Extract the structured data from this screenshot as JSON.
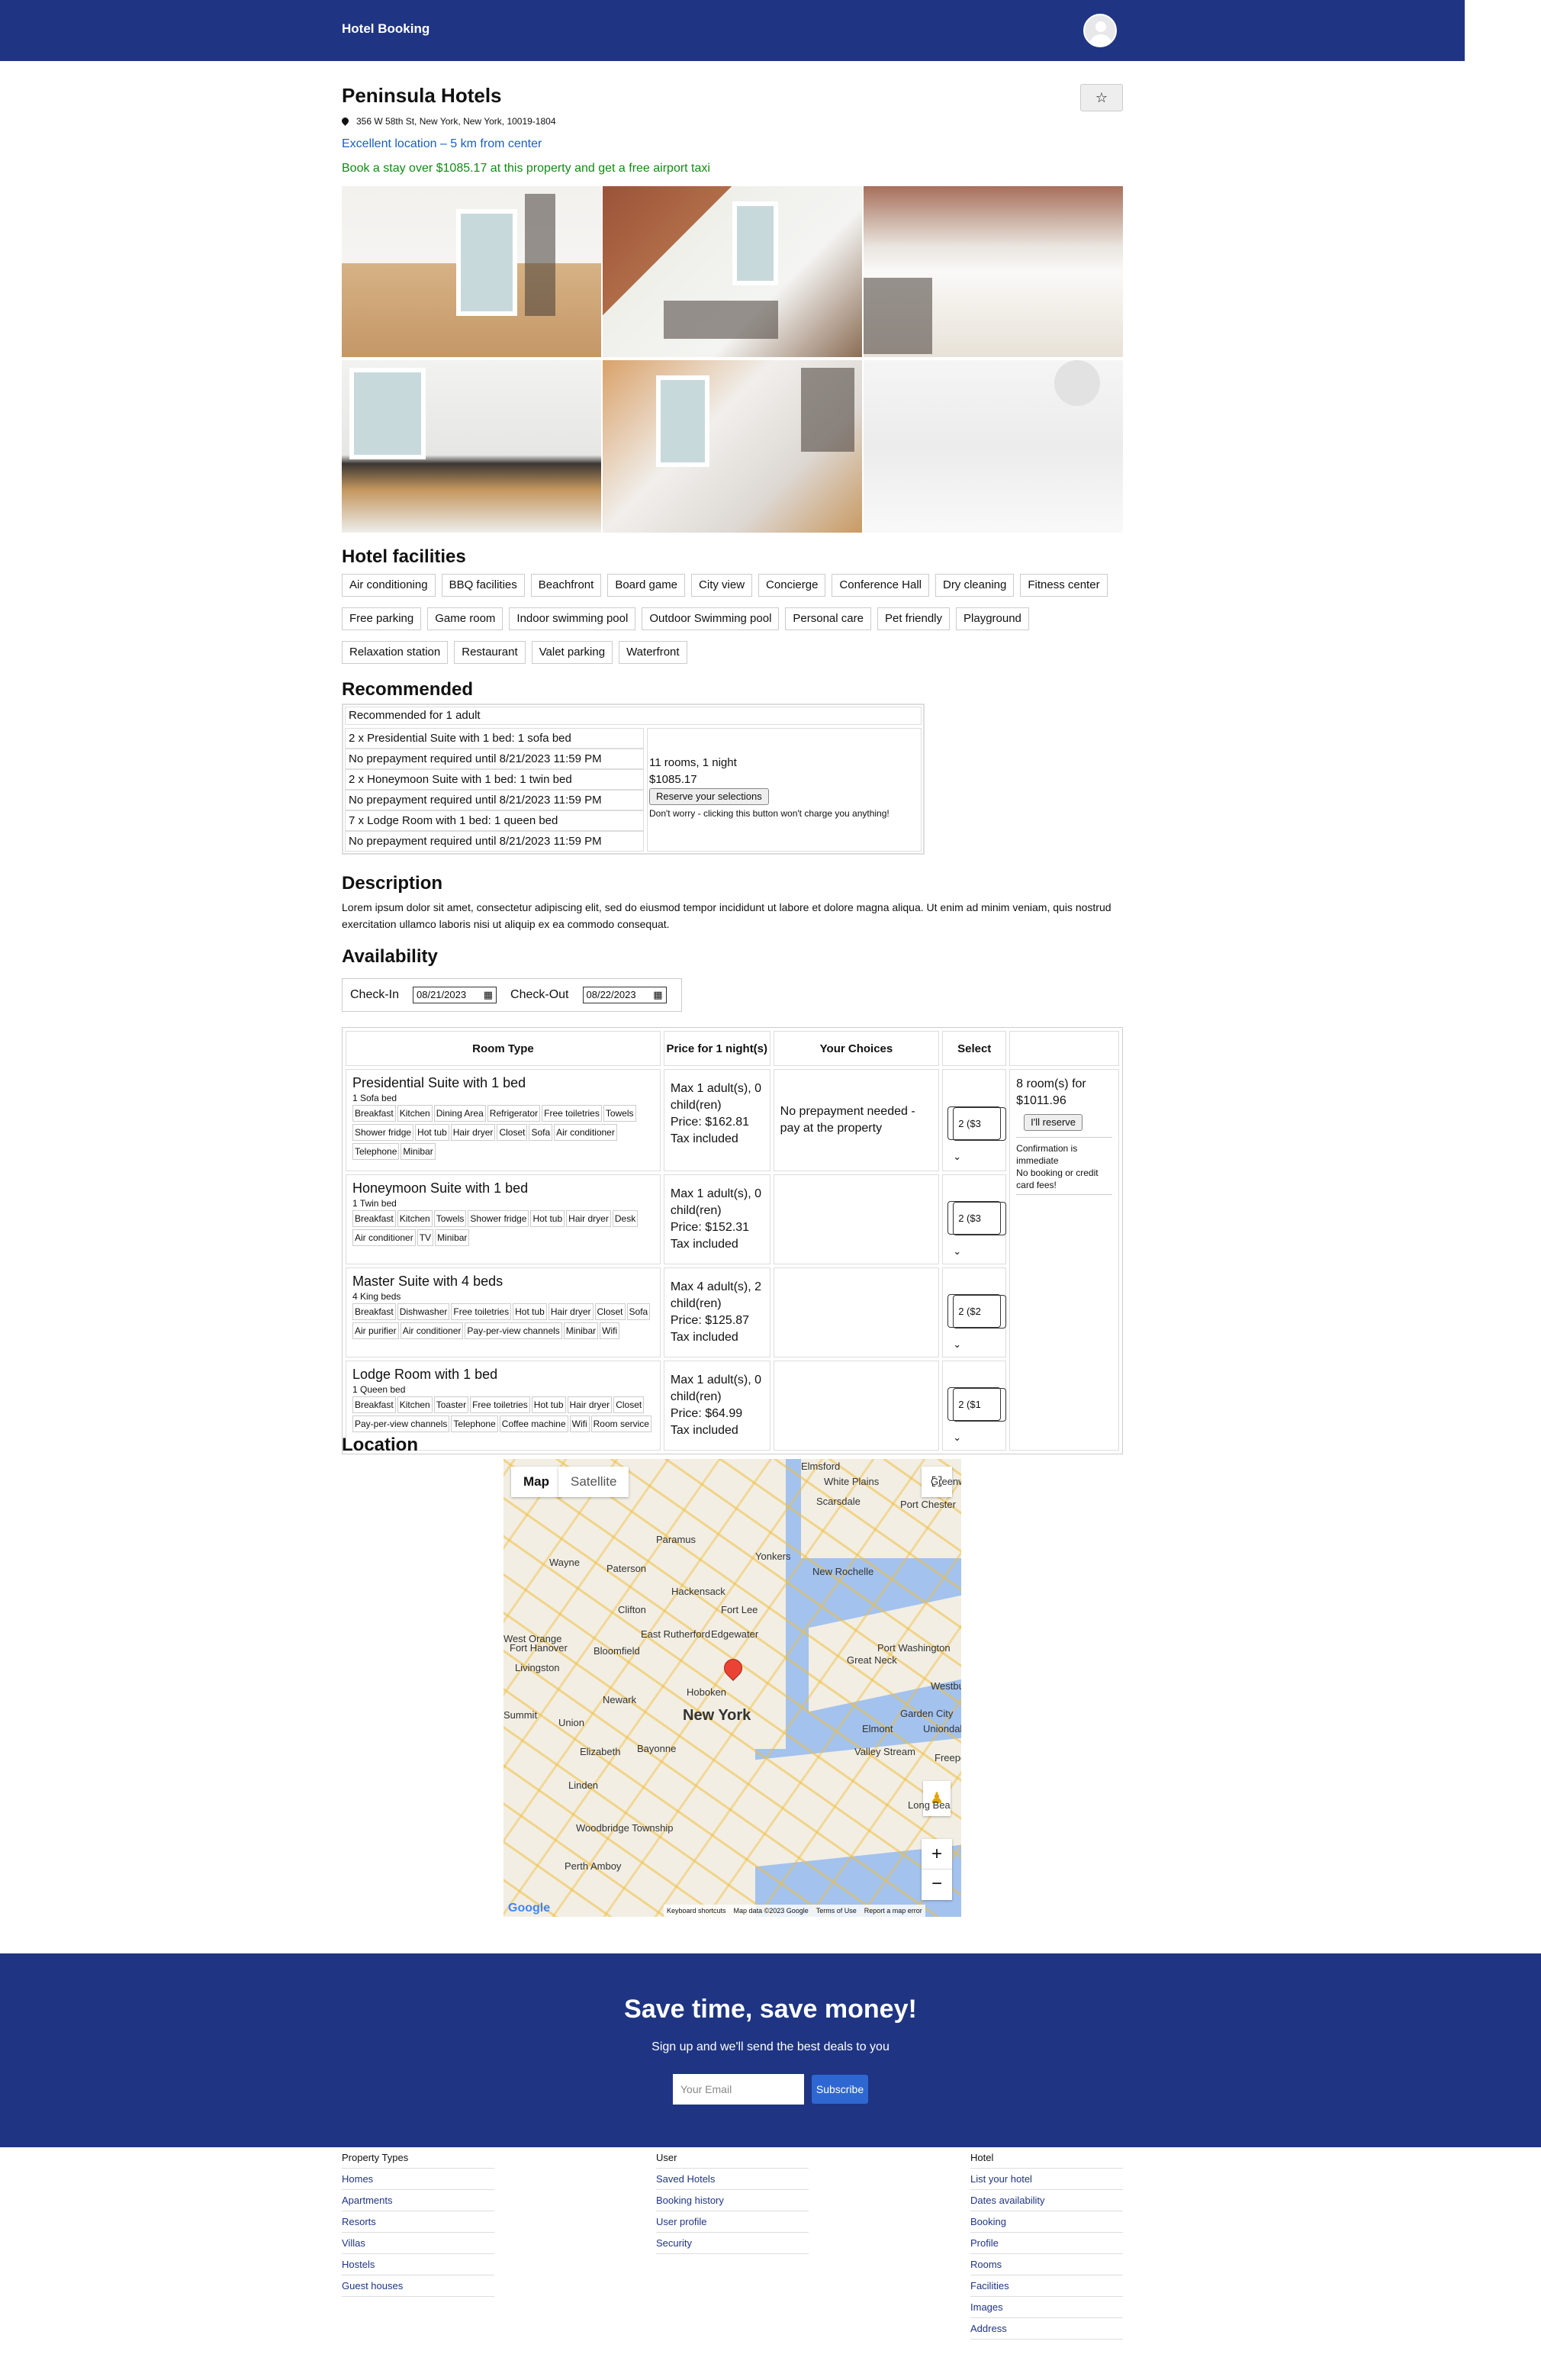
{
  "header": {
    "brand": "Hotel Booking",
    "avatar_icon": "user-avatar-icon"
  },
  "hotel": {
    "name": "Peninsula Hotels",
    "favorite_icon": "star-icon",
    "address": "356 W 58th St, New York, New York, 10019-1804",
    "location_note": "Excellent location – 5 km from center",
    "offer": "Book a stay over $1085.17 at this property and get a free airport taxi"
  },
  "facilities": {
    "title": "Hotel facilities",
    "items": [
      "Air conditioning",
      "BBQ facilities",
      "Beachfront",
      "Board game",
      "City view",
      "Concierge",
      "Conference Hall",
      "Dry cleaning",
      "Fitness center",
      "Free parking",
      "Game room",
      "Indoor swimming pool",
      "Outdoor Swimming pool",
      "Personal care",
      "Pet friendly",
      "Playground",
      "Relaxation station",
      "Restaurant",
      "Valet parking",
      "Waterfront"
    ]
  },
  "recommended": {
    "title": "Recommended",
    "header": "Recommended for 1 adult",
    "rooms": [
      {
        "name": "2 x Presidential Suite with 1 bed: 1 sofa bed",
        "prepay": "No prepayment required until 8/21/2023 11:59 PM"
      },
      {
        "name": "2 x Honeymoon Suite with 1 bed: 1 twin bed",
        "prepay": "No prepayment required until 8/21/2023 11:59 PM"
      },
      {
        "name": "7 x Lodge Room with 1 bed: 1 queen bed",
        "prepay": "No prepayment required until 8/21/2023 11:59 PM"
      }
    ],
    "summary": "11 rooms, 1 night",
    "price": "$1085.17",
    "button": "Reserve your selections",
    "note": "Don't worry - clicking this button won't charge you anything!"
  },
  "description": {
    "title": "Description",
    "text": "Lorem ipsum dolor sit amet, consectetur adipiscing elit, sed do eiusmod tempor incididunt ut labore et dolore magna aliqua. Ut enim ad minim veniam, quis nostrud exercitation ullamco laboris nisi ut aliquip ex ea commodo consequat."
  },
  "availability": {
    "title": "Availability",
    "checkin_label": "Check-In",
    "checkin_value": "08/21/2023",
    "checkout_label": "Check-Out",
    "checkout_value": "08/22/2023",
    "columns": [
      "Room Type",
      "Price for 1 night(s)",
      "Your Choices",
      "Select"
    ],
    "rooms": [
      {
        "name": "Presidential Suite with 1 bed",
        "bed": "1 Sofa bed",
        "amenities": [
          "Breakfast",
          "Kitchen",
          "Dining Area",
          "Refrigerator",
          "Free toiletries",
          "Towels",
          "Shower fridge",
          "Hot tub",
          "Hair dryer",
          "Closet",
          "Sofa",
          "Air conditioner",
          "Telephone",
          "Minibar"
        ],
        "capacity": "Max 1 adult(s), 0 child(ren)",
        "price": "Price: $162.81",
        "tax": "Tax included",
        "choice": "No prepayment needed - pay at the property",
        "select": "2 ($3"
      },
      {
        "name": "Honeymoon Suite with 1 bed",
        "bed": "1 Twin bed",
        "amenities": [
          "Breakfast",
          "Kitchen",
          "Towels",
          "Shower fridge",
          "Hot tub",
          "Hair dryer",
          "Desk",
          "Air conditioner",
          "TV",
          "Minibar"
        ],
        "capacity": "Max 1 adult(s), 0 child(ren)",
        "price": "Price: $152.31",
        "tax": "Tax included",
        "choice": "",
        "select": "2 ($3"
      },
      {
        "name": "Master Suite with 4 beds",
        "bed": "4 King beds",
        "amenities": [
          "Breakfast",
          "Dishwasher",
          "Free toiletries",
          "Hot tub",
          "Hair dryer",
          "Closet",
          "Sofa",
          "Air purifier",
          "Air conditioner",
          "Pay-per-view channels",
          "Minibar",
          "Wifi"
        ],
        "capacity": "Max 4 adult(s), 2 child(ren)",
        "price": "Price: $125.87",
        "tax": "Tax included",
        "choice": "",
        "select": "2 ($2"
      },
      {
        "name": "Lodge Room with 1 bed",
        "bed": "1 Queen bed",
        "amenities": [
          "Breakfast",
          "Kitchen",
          "Toaster",
          "Free toiletries",
          "Hot tub",
          "Hair dryer",
          "Closet",
          "Pay-per-view channels",
          "Telephone",
          "Coffee machine",
          "Wifi",
          "Room service"
        ],
        "capacity": "Max 1 adult(s), 0 child(ren)",
        "price": "Price: $64.99",
        "tax": "Tax included",
        "choice": "",
        "select": "2 ($1"
      }
    ],
    "reserve": {
      "summary": "8 room(s) for $1011.96",
      "button": "I'll reserve",
      "note1": "Confirmation is immediate",
      "note2": "No booking or credit card fees!"
    }
  },
  "location": {
    "title": "Location",
    "map_tab": "Map",
    "satellite_tab": "Satellite",
    "labels": [
      "Elmsford",
      "White Plains",
      "Greenwich",
      "Scarsdale",
      "Port Chester",
      "Paramus",
      "Yonkers",
      "Wayne",
      "Paterson",
      "New Rochelle",
      "Hackensack",
      "Clifton",
      "Fort Lee",
      "East Rutherford",
      "Edgewater",
      "Port Washington",
      "West Orange",
      "Bloomfield",
      "Great Neck",
      "Livingston",
      "Hoboken",
      "Newark",
      "New York",
      "Westbury",
      "Summit",
      "Union",
      "Garden City",
      "Uniondal",
      "Elmont",
      "Elizabeth",
      "Bayonne",
      "Valley Stream",
      "Freepo",
      "Linden",
      "Long Bea",
      "Woodbridge Township",
      "Perth Amboy",
      "Fort Hanover"
    ],
    "attribution": [
      "Keyboard shortcuts",
      "Map data ©2023 Google",
      "Terms of Use",
      "Report a map error"
    ],
    "google": "Google"
  },
  "newsletter": {
    "title": "Save time, save money!",
    "subtitle": "Sign up and we'll send the best deals to you",
    "placeholder": "Your Email",
    "button": "Subscribe"
  },
  "footer": {
    "columns": [
      {
        "title": "Property Types",
        "links": [
          "Homes",
          "Apartments",
          "Resorts",
          "Villas",
          "Hostels",
          "Guest houses"
        ]
      },
      {
        "title": "User",
        "links": [
          "Saved Hotels",
          "Booking history",
          "User profile",
          "Security"
        ]
      },
      {
        "title": "Hotel",
        "links": [
          "List your hotel",
          "Dates availability",
          "Booking",
          "Profile",
          "Rooms",
          "Facilities",
          "Images",
          "Address"
        ]
      }
    ]
  },
  "colors": {
    "primary": "#1f3583",
    "link": "#1a5fc0",
    "offer": "#138a15",
    "subscribe": "#2f67d2"
  }
}
